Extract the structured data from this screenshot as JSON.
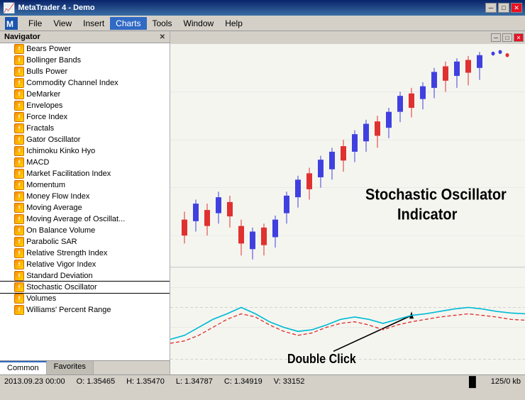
{
  "titleBar": {
    "appName": "MetaTrader 4",
    "windowTitle": "MetaTrader 4 - Demo",
    "btnMinimize": "─",
    "btnMaximize": "□",
    "btnClose": "✕"
  },
  "menuBar": {
    "items": [
      {
        "label": "File",
        "id": "file"
      },
      {
        "label": "View",
        "id": "view"
      },
      {
        "label": "Insert",
        "id": "insert"
      },
      {
        "label": "Charts",
        "id": "charts",
        "active": true
      },
      {
        "label": "Tools",
        "id": "tools"
      },
      {
        "label": "Window",
        "id": "window"
      },
      {
        "label": "Help",
        "id": "help"
      }
    ]
  },
  "navigator": {
    "title": "Navigator",
    "indicators": [
      "Bears Power",
      "Bollinger Bands",
      "Bulls Power",
      "Commodity Channel Index",
      "DeMarker",
      "Envelopes",
      "Force Index",
      "Fractals",
      "Gator Oscillator",
      "Ichimoku Kinko Hyo",
      "MACD",
      "Market Facilitation Index",
      "Momentum",
      "Money Flow Index",
      "Moving Average",
      "Moving Average of Oscillat...",
      "On Balance Volume",
      "Parabolic SAR",
      "Relative Strength Index",
      "Relative Vigor Index",
      "Standard Deviation",
      "Stochastic Oscillator",
      "Volumes",
      "Williams' Percent Range"
    ],
    "selectedIndex": 21,
    "tabs": [
      "Common",
      "Favorites"
    ]
  },
  "chart": {
    "title": "Stochastic Oscillator Indicator",
    "doubleClickLabel": "Double Click",
    "annotation": "Stochastic Oscillator\nIndicator"
  },
  "statusBar": {
    "datetime": "2013.09.23 00:00",
    "open": "O: 1.35465",
    "high": "H: 1.35470",
    "low": "L: 1.34787",
    "close": "C: 1.34919",
    "volume": "V: 33152",
    "size": "125/0 kb"
  }
}
